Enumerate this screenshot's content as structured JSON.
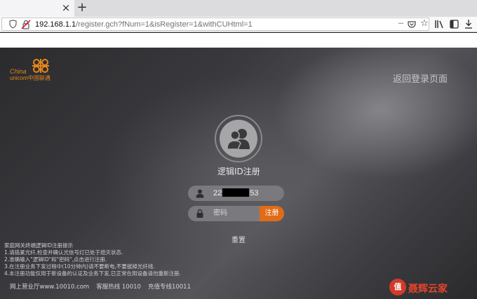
{
  "browser": {
    "tab_close": "×",
    "new_tab": "+",
    "url_host": "192.168.1.1",
    "url_path": "/register.gch?fNum=1&isRegister=1&withCUHtml=1",
    "more_glyph": "···",
    "star_glyph": "☆"
  },
  "logo": {
    "china": "China",
    "unicom": "unicom中国联通",
    "color": "#e3861c"
  },
  "header": {
    "back_link": "返回登录页面"
  },
  "form": {
    "title": "逻辑ID注册",
    "user_value_prefix": "22",
    "user_value_suffix": "53",
    "password_placeholder": "密码",
    "register_label": "注册",
    "reset_label": "重置",
    "accent_color": "#e06c18"
  },
  "notes": {
    "heading": "家庭网关终端逻辑ID注册提示",
    "lines": [
      "1.请插紧光纤,检查并确认光信号灯已处于熄灭状态.",
      "2.准确输入\"逻辑ID\"和\"密码\",点击进行注册.",
      "3.在注册业务下发过程中(10分钟内)请不要断电,不要拔掉光纤线.",
      "4.本注册功能仅用于新设备的认证及业务下发,已正常在用设备请勿重新注册."
    ]
  },
  "footer": {
    "site": "网上营业厅www.10010.com",
    "hotline": "客服热线 10010",
    "recharge": "充值专线10011"
  },
  "watermark": {
    "badge": "值",
    "text": "聂辉云家"
  }
}
